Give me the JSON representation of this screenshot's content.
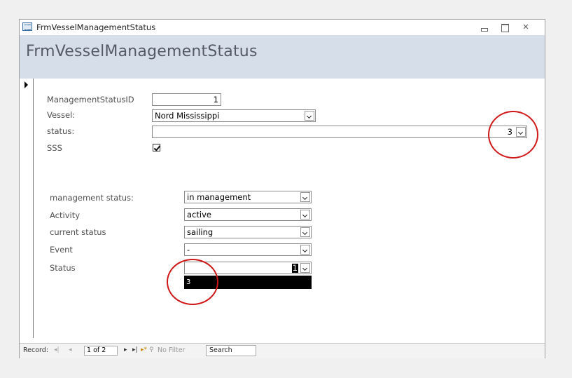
{
  "window": {
    "title": "FrmVesselManagementStatus",
    "header_title": "FrmVesselManagementStatus"
  },
  "form": {
    "management_status_id": {
      "label": "ManagementStatusID",
      "value": "1"
    },
    "vessel": {
      "label": "Vessel:",
      "value": "Nord Mississippi"
    },
    "status_top": {
      "label": "status:",
      "value": "3"
    },
    "sss": {
      "label": "SSS",
      "checked": true
    },
    "management_status": {
      "label": "management status:",
      "value": "in management"
    },
    "activity": {
      "label": "Activity",
      "value": "active"
    },
    "current_status": {
      "label": "current status",
      "value": "sailing"
    },
    "event": {
      "label": "Event",
      "value": "-"
    },
    "status_bottom": {
      "label": "Status",
      "value": "1",
      "dropdown_options": [
        "3"
      ]
    }
  },
  "navigation": {
    "record_label": "Record:",
    "first_icon": "first-record-icon",
    "prev_icon": "prev-record-icon",
    "position": "1 of 2",
    "next_icon": "next-record-icon",
    "last_icon": "last-record-icon",
    "new_icon": "new-record-icon",
    "filter_text": "No Filter",
    "search_text": "Search"
  },
  "annotation_color": "#d01818",
  "header_color": "#d6dfe9"
}
